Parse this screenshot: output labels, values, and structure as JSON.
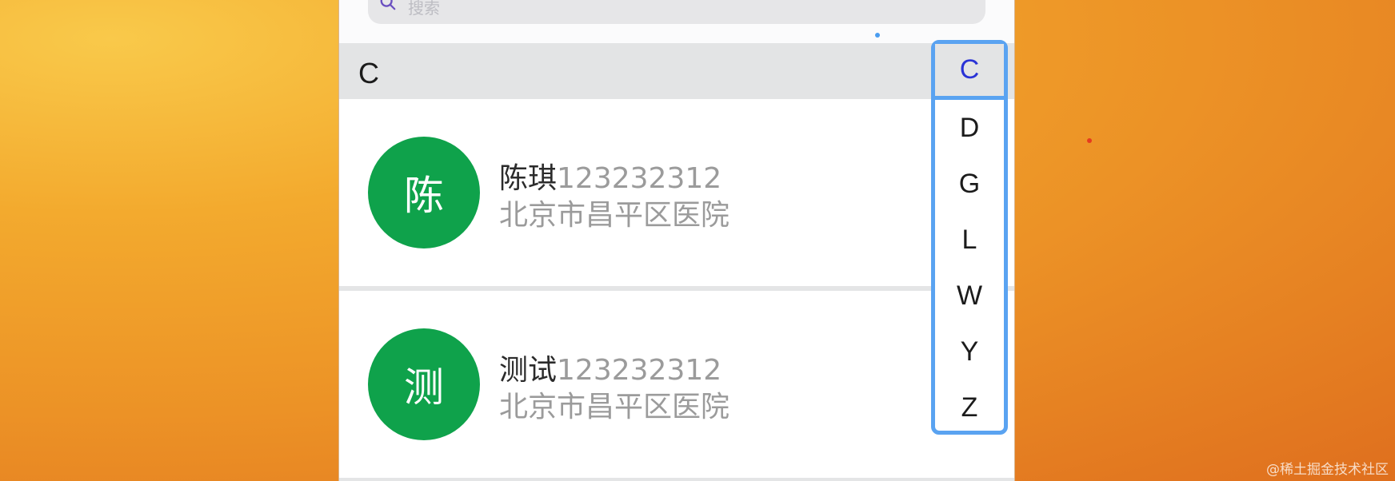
{
  "search": {
    "placeholder": "搜索",
    "icon": "search-icon"
  },
  "section": {
    "letter": "C"
  },
  "contacts": [
    {
      "avatar_char": "陈",
      "name": "陈琪",
      "phone": "123232312",
      "address": "北京市昌平区医院",
      "avatar_color": "#0fa24b"
    },
    {
      "avatar_char": "测",
      "name": "测试",
      "phone": "123232312",
      "address": "北京市昌平区医院",
      "avatar_color": "#0fa24b"
    }
  ],
  "index_bar": {
    "letters": [
      "C",
      "D",
      "G",
      "L",
      "W",
      "Y",
      "Z"
    ],
    "active": "C",
    "active_color": "#2a33d6",
    "border_color": "#5aa3f1"
  },
  "watermark": "@稀土掘金技术社区"
}
